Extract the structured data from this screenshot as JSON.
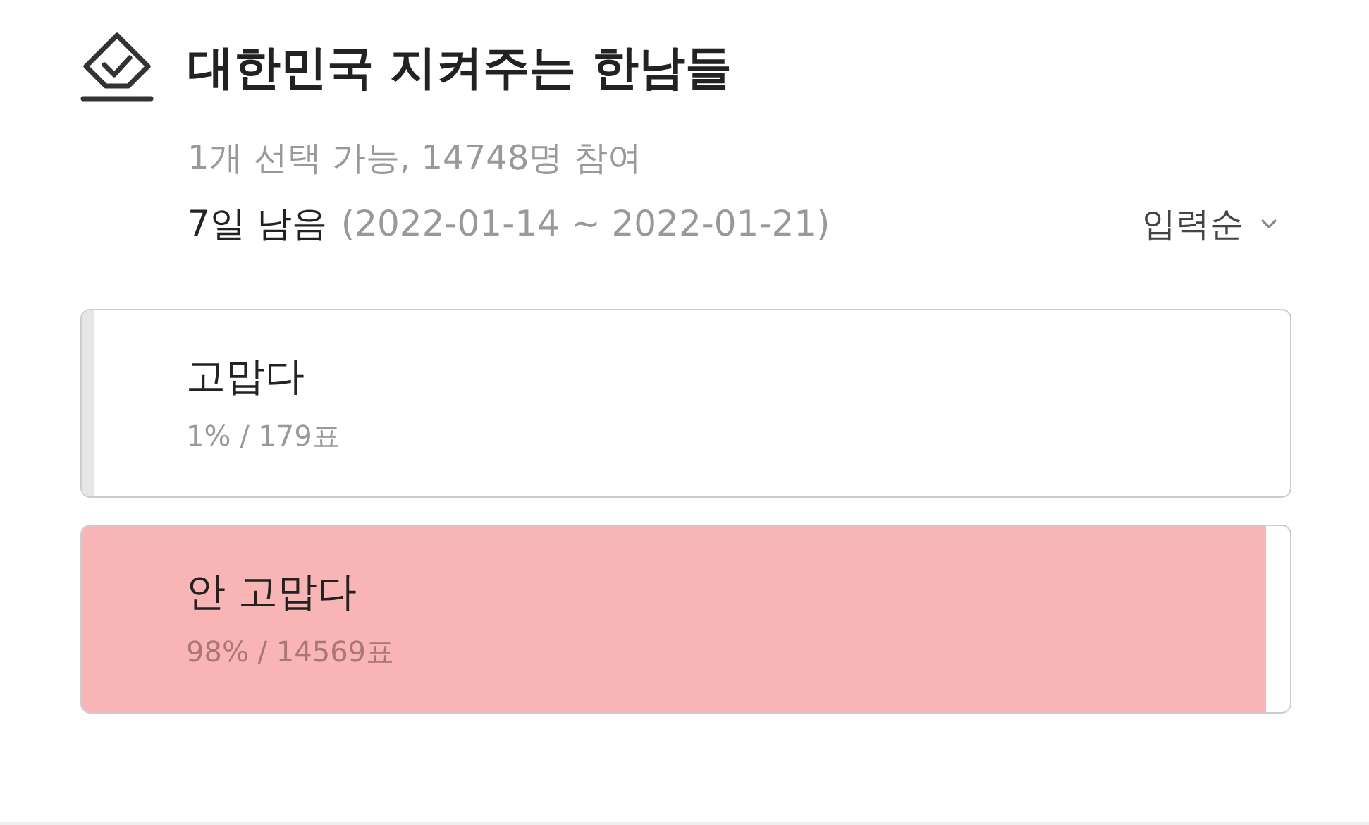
{
  "poll": {
    "title": "대한민국 지켜주는 한남들",
    "info": "1개 선택 가능, 14748명 참여",
    "remaining": "7일 남음",
    "period": "(2022-01-14 ~ 2022-01-21)",
    "sort": {
      "label": "입력순"
    }
  },
  "options": [
    {
      "label": "고맙다",
      "stats": "1% / 179표",
      "level": 0.01,
      "color": "#e6e6e6"
    },
    {
      "label": "안 고맙다",
      "stats": "98% / 14569표",
      "level": 0.98,
      "color": "#f9b5b5"
    }
  ]
}
